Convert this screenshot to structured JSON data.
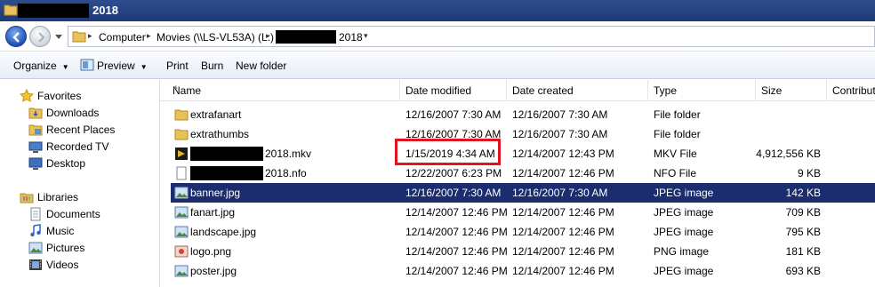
{
  "window": {
    "title": "2018"
  },
  "address": {
    "crumbs": [
      "Computer",
      "Movies (\\\\LS-VL53A) (L:)",
      "2018"
    ]
  },
  "toolbar": {
    "organize": "Organize",
    "preview": "Preview",
    "print": "Print",
    "burn": "Burn",
    "new_folder": "New folder"
  },
  "nav": {
    "favorites": "Favorites",
    "downloads": "Downloads",
    "recent_places": "Recent Places",
    "recorded_tv": "Recorded TV",
    "desktop": "Desktop",
    "libraries": "Libraries",
    "documents": "Documents",
    "music": "Music",
    "pictures": "Pictures",
    "videos": "Videos"
  },
  "columns": {
    "name": "Name",
    "date_modified": "Date modified",
    "date_created": "Date created",
    "type": "Type",
    "size": "Size",
    "contributing": "Contributing"
  },
  "files": [
    {
      "name": "extrafanart",
      "modified": "12/16/2007 7:30 AM",
      "created": "12/16/2007 7:30 AM",
      "type": "File folder",
      "size": "",
      "icon": "folder-icon"
    },
    {
      "name": "extrathumbs",
      "modified": "12/16/2007 7:30 AM",
      "created": "12/16/2007 7:30 AM",
      "type": "File folder",
      "size": "",
      "icon": "folder-icon"
    },
    {
      "name": "2018.mkv",
      "modified": "1/15/2019 4:34 AM",
      "created": "12/14/2007 12:43 PM",
      "type": "MKV File",
      "size": "4,912,556 KB",
      "icon": "mkv-file-icon"
    },
    {
      "name": "2018.nfo",
      "modified": "12/22/2007 6:23 PM",
      "created": "12/14/2007 12:46 PM",
      "type": "NFO File",
      "size": "9 KB",
      "icon": "nfo-file-icon"
    },
    {
      "name": "banner.jpg",
      "modified": "12/16/2007 7:30 AM",
      "created": "12/16/2007 7:30 AM",
      "type": "JPEG image",
      "size": "142 KB",
      "icon": "image-file-icon"
    },
    {
      "name": "fanart.jpg",
      "modified": "12/14/2007 12:46 PM",
      "created": "12/14/2007 12:46 PM",
      "type": "JPEG image",
      "size": "709 KB",
      "icon": "image-file-icon"
    },
    {
      "name": "landscape.jpg",
      "modified": "12/14/2007 12:46 PM",
      "created": "12/14/2007 12:46 PM",
      "type": "JPEG image",
      "size": "795 KB",
      "icon": "image-file-icon"
    },
    {
      "name": "logo.png",
      "modified": "12/14/2007 12:46 PM",
      "created": "12/14/2007 12:46 PM",
      "type": "PNG image",
      "size": "181 KB",
      "icon": "image-file-icon"
    },
    {
      "name": "poster.jpg",
      "modified": "12/14/2007 12:46 PM",
      "created": "12/14/2007 12:46 PM",
      "type": "JPEG image",
      "size": "693 KB",
      "icon": "image-file-icon"
    }
  ],
  "colors": {
    "selection": "#1b2d6e",
    "highlight_box": "#e0141e",
    "titlebar": "#2c4d8c"
  }
}
